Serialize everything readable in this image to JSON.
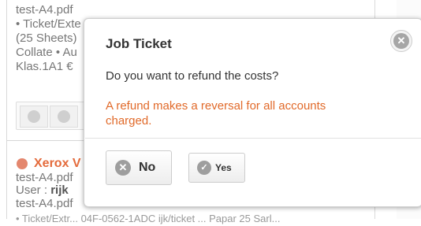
{
  "background": {
    "ticket1": {
      "lines": [
        "test-A4.pdf",
        "• Ticket/Exte",
        "(25 Sheets)",
        "Collate • Au",
        "Klas.1A1 €"
      ]
    },
    "ticket2": {
      "printer": "Xerox V",
      "file_lines": [
        "test-A4.pdf",
        "test-A4.pdf"
      ],
      "user_label": "User :",
      "user_name": "rijk",
      "partial_line": "• Ticket/Extr... 04F-0562-1ADC ijk/ticket ... Papar 25 Sarl..."
    },
    "status_colors": {
      "printer_dot": "#e4876e",
      "printer_text": "#e46b3c"
    }
  },
  "dialog": {
    "title": "Job Ticket",
    "question": "Do you want to refund the costs?",
    "warning": "A refund makes a reversal for all accounts charged.",
    "close_icon": "close-icon",
    "buttons": {
      "no_label": "No",
      "yes_label": "Yes",
      "no_icon": "x-circle-icon",
      "yes_icon": "check-circle-icon"
    },
    "colors": {
      "warning": "#e16a2a",
      "icon_gray": "#9e9e9e"
    }
  }
}
